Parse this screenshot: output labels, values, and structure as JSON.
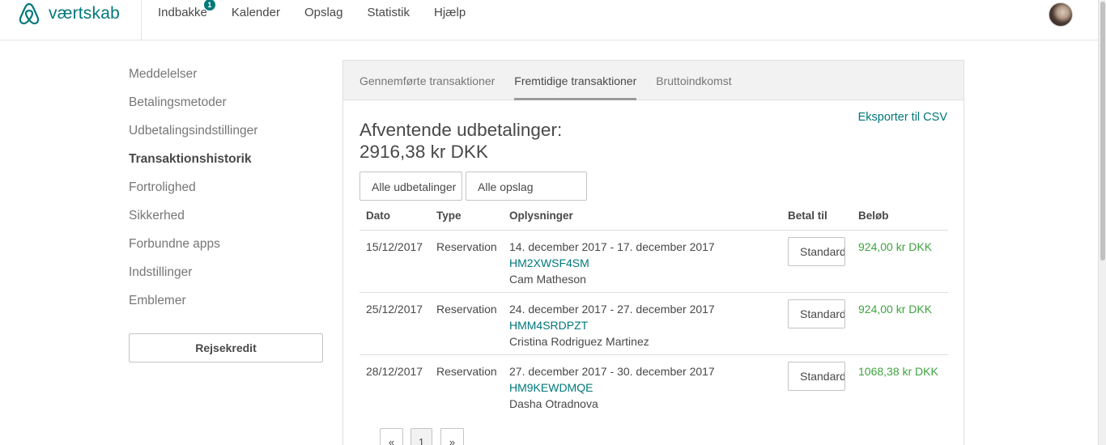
{
  "topbar": {
    "brand": "værtskab",
    "nav": [
      "Indbakke",
      "Kalender",
      "Opslag",
      "Statistik",
      "Hjælp"
    ],
    "inbox_badge": "1"
  },
  "sidebar": {
    "items": [
      "Meddelelser",
      "Betalingsmetoder",
      "Udbetalingsindstillinger",
      "Transaktionshistorik",
      "Fortrolighed",
      "Sikkerhed",
      "Forbundne apps",
      "Indstillinger",
      "Emblemer"
    ],
    "active_item": "Transaktionshistorik",
    "credit_button": "Rejsekredit"
  },
  "main": {
    "tabs": [
      "Gennemførte transaktioner",
      "Fremtidige transaktioner",
      "Bruttoindkomst"
    ],
    "active_tab": "Fremtidige transaktioner",
    "export_link": "Eksporter til CSV",
    "heading_line1": "Afventende udbetalinger:",
    "heading_line2": "2916,38 kr DKK",
    "filter_payouts": "Alle udbetalinger",
    "filter_listings": "Alle opslag",
    "columns": [
      "Dato",
      "Type",
      "Oplysninger",
      "Betal til",
      "Beløb"
    ],
    "rows": [
      {
        "date": "15/12/2017",
        "type": "Reservation",
        "period": "14. december 2017 - 17. december 2017",
        "code": "HM2XWSF4SM",
        "guest": "Cam Matheson",
        "pay_to": "Standard",
        "amount": "924,00 kr DKK"
      },
      {
        "date": "25/12/2017",
        "type": "Reservation",
        "period": "24. december 2017 - 27. december 2017",
        "code": "HMM4SRDPZT",
        "guest": "Cristina Rodriguez Martinez",
        "pay_to": "Standard",
        "amount": "924,00 kr DKK"
      },
      {
        "date": "28/12/2017",
        "type": "Reservation",
        "period": "27. december 2017 - 30. december 2017",
        "code": "HM9KEWDMQE",
        "guest": "Dasha Otradnova",
        "pay_to": "Standard",
        "amount": "1068,38 kr DKK"
      }
    ],
    "pagination": {
      "prev": "«",
      "current": "1",
      "next": "»"
    }
  },
  "colors": {
    "accent": "#00787a",
    "amount": "#3fa33f"
  }
}
